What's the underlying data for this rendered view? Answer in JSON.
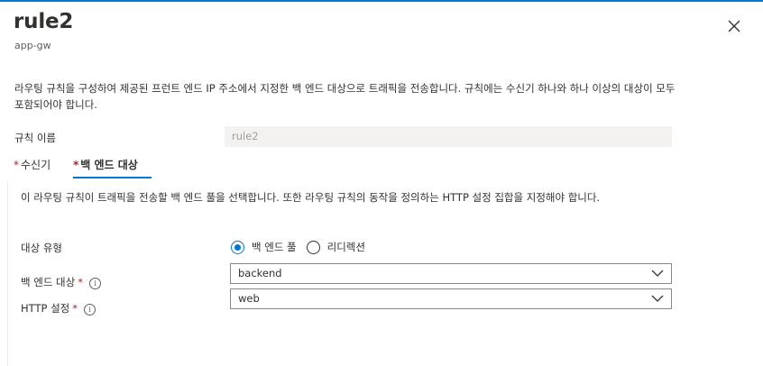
{
  "panel": {
    "title": "rule2",
    "subtitle": "app-gw",
    "description": "라우팅 규칙을 구성하여 제공된 프런트 엔드 IP 주소에서 지정한 백 엔드 대상으로 트래픽을 전송합니다. 규칙에는 수신기 하나와 하나 이상의 대상이 모두 포함되어야 합니다."
  },
  "rule_name": {
    "label": "규칙 이름",
    "value": "rule2"
  },
  "tabs": [
    {
      "label": "수신기",
      "required_mark": "*",
      "selected": false
    },
    {
      "label": "백 엔드 대상",
      "required_mark": "*",
      "selected": true
    }
  ],
  "backend_tab": {
    "description": "이 라우팅 규칙이 트래픽을 전송할 백 엔드 풀을 선택합니다. 또한 라우팅 규칙의 동작을 정의하는 HTTP 설정 집합을 지정해야 합니다.",
    "target_type": {
      "label": "대상 유형",
      "options": [
        {
          "label": "백 엔드 풀",
          "checked": true
        },
        {
          "label": "리디렉션",
          "checked": false
        }
      ]
    },
    "backend_target": {
      "label": "백 엔드 대상",
      "required_mark": "*",
      "info_icon": "i",
      "value": "backend"
    },
    "http_settings": {
      "label": "HTTP 설정",
      "required_mark": "*",
      "info_icon": "i",
      "value": "web"
    }
  },
  "colors": {
    "accent": "#0078d4",
    "required": "#a4262c",
    "disabled_field_bg": "#f3f2f1"
  },
  "icons": {
    "close": "close-icon",
    "info": "info-icon",
    "dropdown": "chevron-down-icon"
  }
}
